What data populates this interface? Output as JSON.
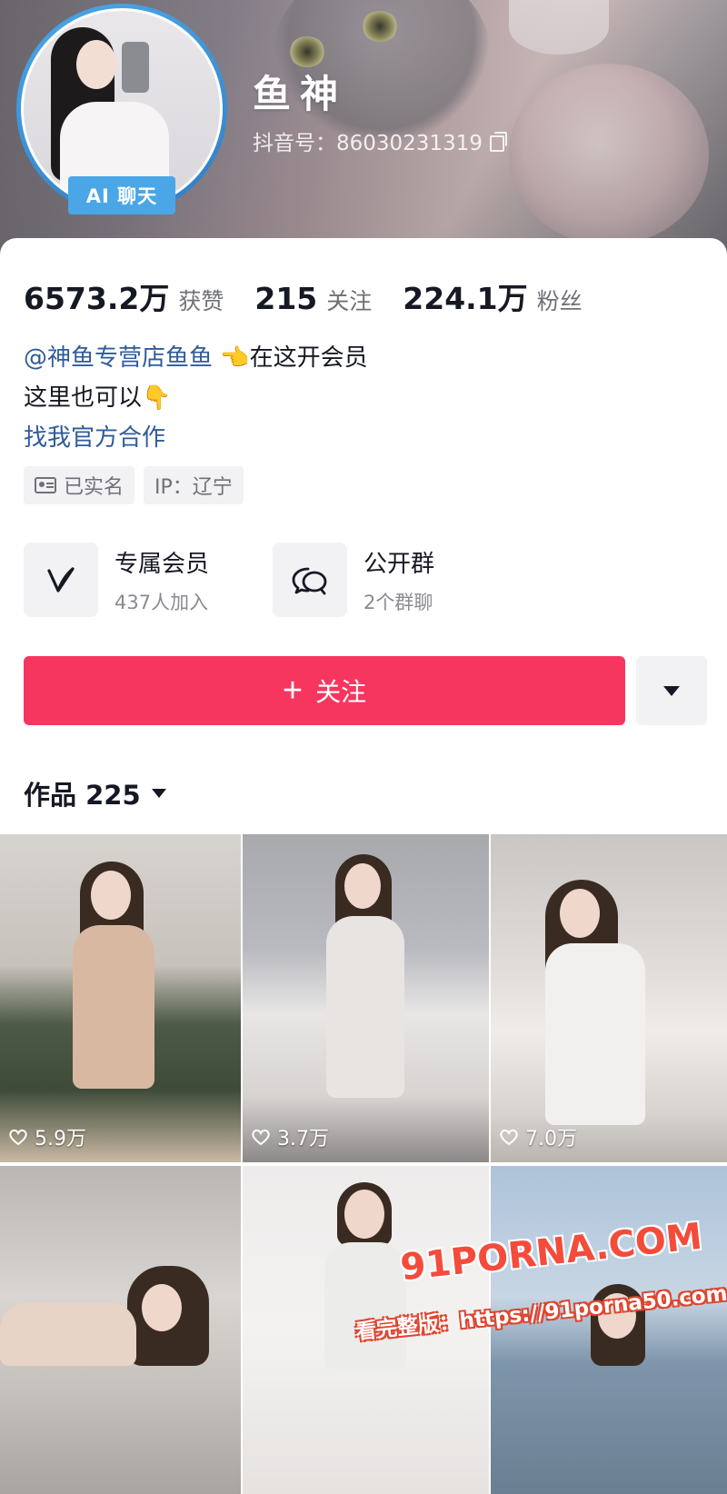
{
  "profile": {
    "nickname": "鱼神",
    "uid_label": "抖音号：86030231319",
    "ai_badge": "AI 聊天"
  },
  "stats": {
    "likes_num": "6573.2万",
    "likes_label": "获赞",
    "following_num": "215",
    "following_label": "关注",
    "followers_num": "224.1万",
    "followers_label": "粉丝"
  },
  "bio": {
    "mention": "@神鱼专营店鱼鱼",
    "line1_emoji": "👈",
    "line1_rest": "在这开会员",
    "line2_text": "这里也可以",
    "line2_emoji": "👇",
    "line3_link": "找我官方合作"
  },
  "tags": {
    "verified": "已实名",
    "ip": "IP：辽宁"
  },
  "features": [
    {
      "title": "专属会员",
      "sub": "437人加入",
      "icon": "vip-v-icon"
    },
    {
      "title": "公开群",
      "sub": "2个群聊",
      "icon": "chat-bubbles-icon"
    }
  ],
  "actions": {
    "follow_plus": "+",
    "follow_label": "关注"
  },
  "works": {
    "tab_label": "作品 225",
    "items": [
      {
        "likes": "5.9万"
      },
      {
        "likes": "3.7万"
      },
      {
        "likes": "7.0万"
      },
      {
        "likes": ""
      },
      {
        "likes": ""
      },
      {
        "likes": ""
      }
    ]
  },
  "watermark": {
    "logo": "91PORNA.COM",
    "text": "看完整版：https://91porna50.com"
  },
  "colors": {
    "follow_button": "#f73660",
    "avatar_ring": "#4aa6e6",
    "link": "#2f5b9a"
  }
}
